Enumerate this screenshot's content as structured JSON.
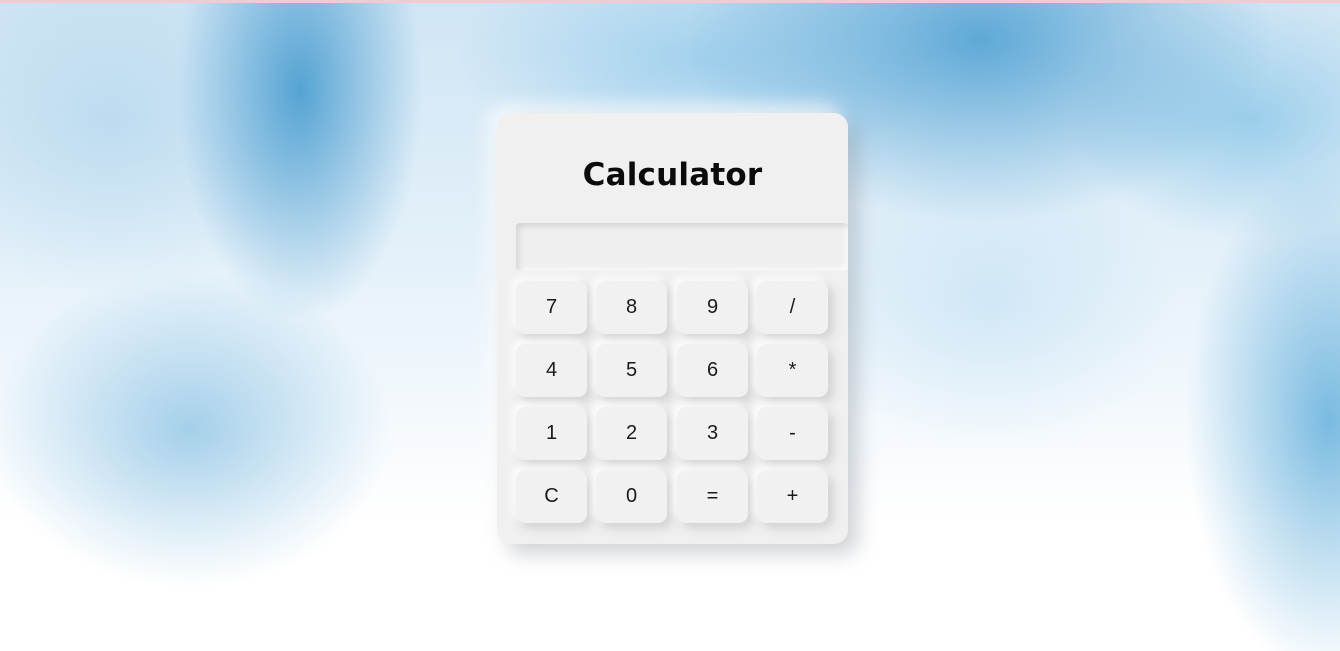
{
  "calculator": {
    "title": "Calculator",
    "display_value": "",
    "keys": {
      "k7": "7",
      "k8": "8",
      "k9": "9",
      "div": "/",
      "k4": "4",
      "k5": "5",
      "k6": "6",
      "mul": "*",
      "k1": "1",
      "k2": "2",
      "k3": "3",
      "sub": "-",
      "clear": "C",
      "k0": "0",
      "equals": "=",
      "add": "+"
    }
  }
}
